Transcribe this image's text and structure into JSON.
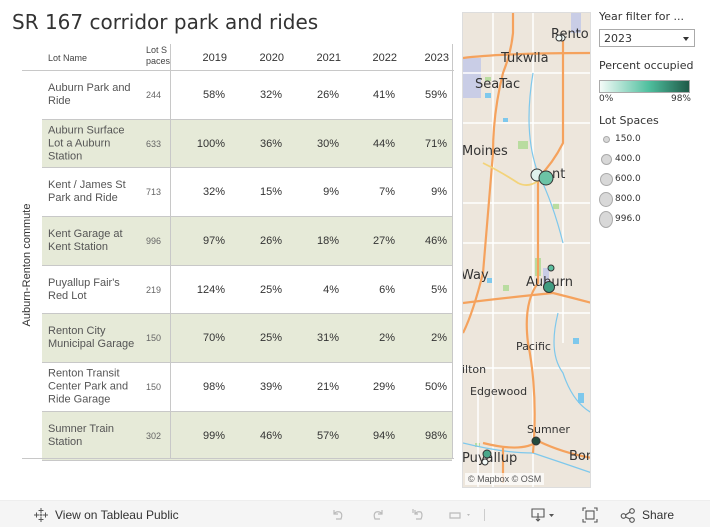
{
  "title": "SR 167 corridor park and rides",
  "table": {
    "headers": {
      "lot_name": "Lot Name",
      "lot_spaces": "Lot S paces",
      "years": [
        "2019",
        "2020",
        "2021",
        "2022",
        "2023"
      ]
    },
    "group_label": "Auburn-Renton commute",
    "rows": [
      {
        "name": "Auburn Park and Ride",
        "spaces": "244",
        "values": [
          "58%",
          "32%",
          "26%",
          "41%",
          "59%"
        ]
      },
      {
        "name": "Auburn Surface Lot a Auburn Station",
        "spaces": "633",
        "values": [
          "100%",
          "36%",
          "30%",
          "44%",
          "71%"
        ]
      },
      {
        "name": "Kent / James St Park and Ride",
        "spaces": "713",
        "values": [
          "32%",
          "15%",
          "9%",
          "7%",
          "9%"
        ]
      },
      {
        "name": "Kent Garage at Kent Station",
        "spaces": "996",
        "values": [
          "97%",
          "26%",
          "18%",
          "27%",
          "46%"
        ]
      },
      {
        "name": "Puyallup Fair's Red Lot",
        "spaces": "219",
        "values": [
          "124%",
          "25%",
          "4%",
          "6%",
          "5%"
        ]
      },
      {
        "name": "Renton City Municipal Garage",
        "spaces": "150",
        "values": [
          "70%",
          "25%",
          "31%",
          "2%",
          "2%"
        ]
      },
      {
        "name": "Renton Transit Center Park and Ride Garage",
        "spaces": "150",
        "values": [
          "98%",
          "39%",
          "21%",
          "29%",
          "50%"
        ]
      },
      {
        "name": "Sumner Train Station",
        "spaces": "302",
        "values": [
          "99%",
          "46%",
          "57%",
          "94%",
          "98%"
        ]
      }
    ]
  },
  "map": {
    "labels": [
      "Rento",
      "Tukwila",
      "SeaTac",
      "Moines",
      "nt",
      "Way",
      "Auburn",
      "Pacific",
      "ilton",
      "Edgewood",
      "Sumner",
      "Puyallup",
      "Bon"
    ],
    "attribution": "© Mapbox  © OSM",
    "colors": {
      "low": "#dff2ec",
      "mid": "#5cbf9f",
      "dark": "#2e5e4e",
      "road": "#f5a25d",
      "water": "#7ec8ec",
      "park": "#b9dca0"
    }
  },
  "filters": {
    "year_label": "Year filter for ...",
    "year_value": "2023",
    "percent_label": "Percent occupied",
    "percent_min": "0%",
    "percent_max": "98%",
    "size_label": "Lot Spaces",
    "size_items": [
      "150.0",
      "400.0",
      "600.0",
      "800.0",
      "996.0"
    ]
  },
  "toolbar": {
    "view_on": "View on Tableau Public",
    "share": "Share"
  }
}
